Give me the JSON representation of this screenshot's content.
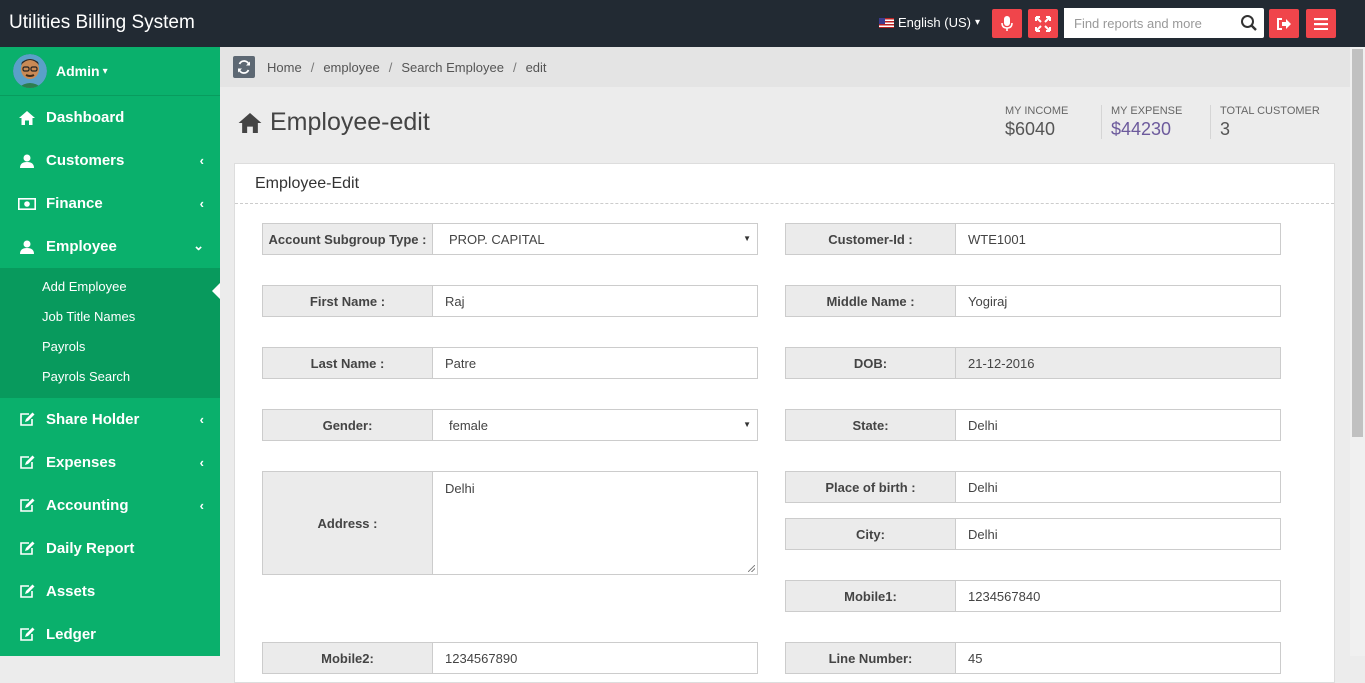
{
  "app": {
    "title": "Utilities Billing System"
  },
  "topbar": {
    "language": "English (US)",
    "search_placeholder": "Find reports and more",
    "accent": "#f0454b"
  },
  "sidebar": {
    "user": "Admin",
    "items": [
      {
        "label": "Dashboard"
      },
      {
        "label": "Customers"
      },
      {
        "label": "Finance"
      },
      {
        "label": "Employee"
      },
      {
        "label": "Share Holder"
      },
      {
        "label": "Expenses"
      },
      {
        "label": "Accounting"
      },
      {
        "label": "Daily Report"
      },
      {
        "label": "Assets"
      },
      {
        "label": "Ledger"
      }
    ],
    "employee_submenu": [
      "Add Employee",
      "Job Title Names",
      "Payrols",
      "Payrols Search"
    ],
    "color": "#0ab06c"
  },
  "breadcrumb": [
    "Home",
    "employee",
    "Search Employee",
    "edit"
  ],
  "page": {
    "title": "Employee-edit"
  },
  "stats": [
    {
      "label": "MY INCOME",
      "value": "$6040"
    },
    {
      "label": "MY EXPENSE",
      "value": "$44230"
    },
    {
      "label": "TOTAL CUSTOMER",
      "value": "3"
    }
  ],
  "panel": {
    "title": "Employee-Edit",
    "fields": {
      "subgroup": {
        "label": "Account Subgroup Type :",
        "value": "PROP. CAPITAL"
      },
      "customer_id": {
        "label": "Customer-Id :",
        "value": "WTE1001"
      },
      "first_name": {
        "label": "First Name :",
        "value": "Raj"
      },
      "middle_name": {
        "label": "Middle Name :",
        "value": "Yogiraj"
      },
      "last_name": {
        "label": "Last Name :",
        "value": "Patre"
      },
      "dob": {
        "label": "DOB:",
        "value": "21-12-2016"
      },
      "gender": {
        "label": "Gender:",
        "value": "female"
      },
      "state": {
        "label": "State:",
        "value": "Delhi"
      },
      "address": {
        "label": "Address :",
        "value": "Delhi"
      },
      "place_of_birth": {
        "label": "Place of birth :",
        "value": "Delhi"
      },
      "city": {
        "label": "City:",
        "value": "Delhi"
      },
      "mobile1": {
        "label": "Mobile1:",
        "value": "1234567840"
      },
      "mobile2": {
        "label": "Mobile2:",
        "value": "1234567890"
      },
      "line_number": {
        "label": "Line Number:",
        "value": "45"
      }
    }
  }
}
